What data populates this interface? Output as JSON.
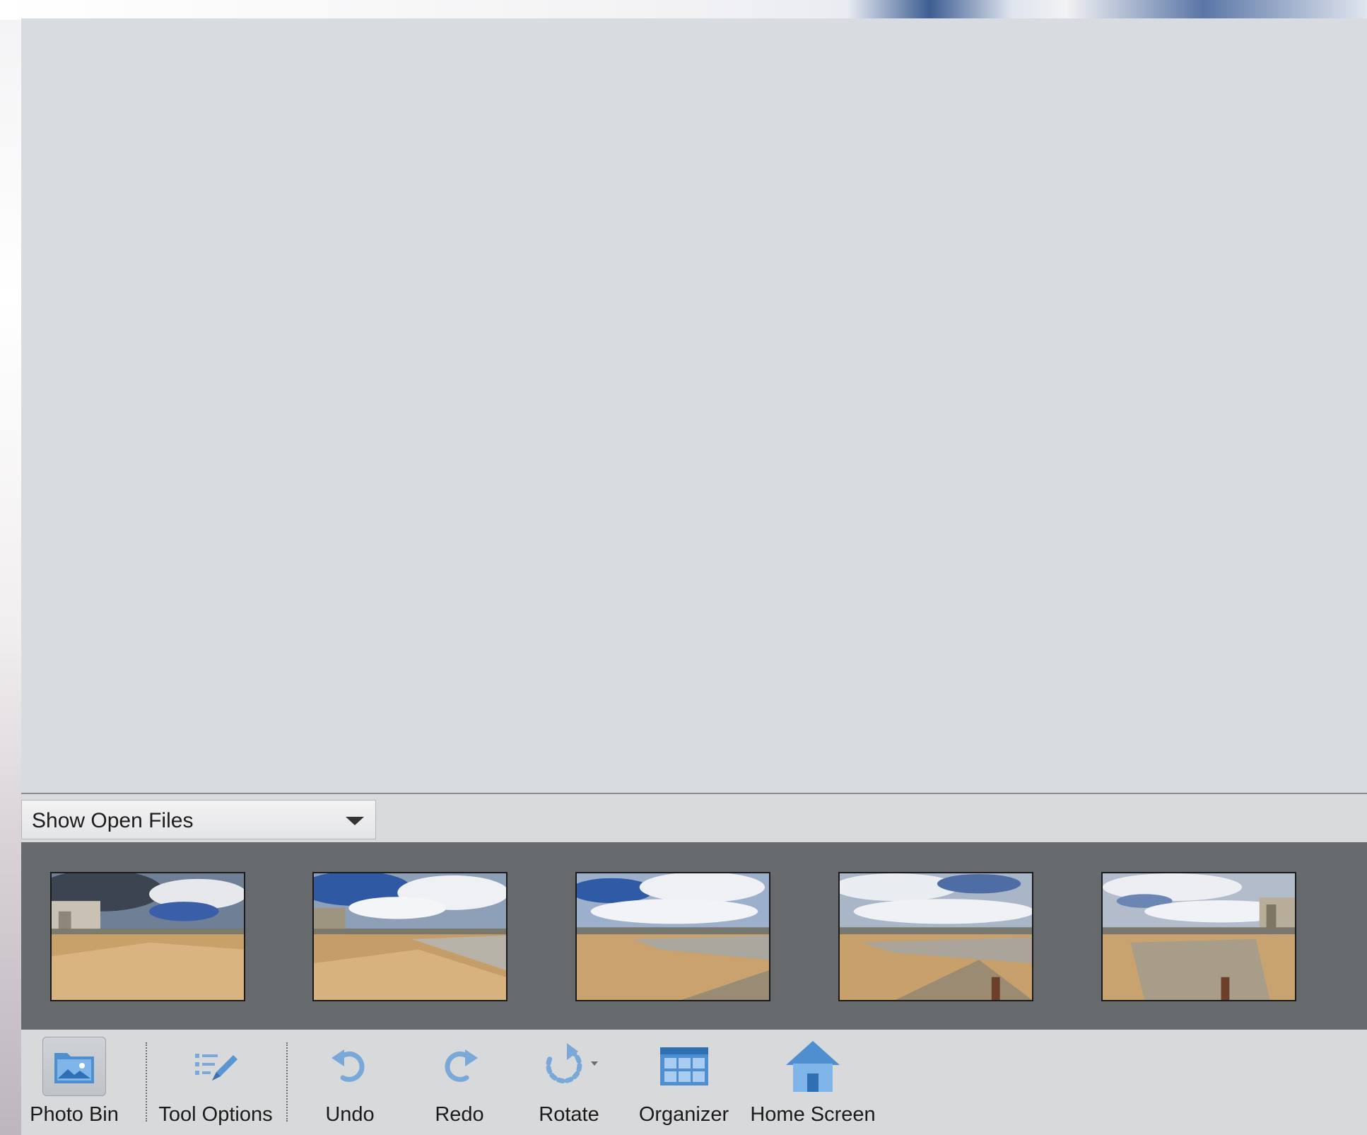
{
  "bin_header": {
    "dropdown": {
      "selected": "Show Open Files"
    }
  },
  "photo_bin": {
    "thumbnails": [
      {
        "name": "thumb-1"
      },
      {
        "name": "thumb-2"
      },
      {
        "name": "thumb-3"
      },
      {
        "name": "thumb-4"
      },
      {
        "name": "thumb-5"
      }
    ]
  },
  "toolbar": {
    "photo_bin": {
      "label": "Photo Bin",
      "icon": "photo-bin-icon",
      "active": true
    },
    "tool_options": {
      "label": "Tool Options",
      "icon": "tool-options-icon"
    },
    "undo": {
      "label": "Undo",
      "icon": "undo-icon"
    },
    "redo": {
      "label": "Redo",
      "icon": "redo-icon"
    },
    "rotate": {
      "label": "Rotate",
      "icon": "rotate-icon"
    },
    "organizer": {
      "label": "Organizer",
      "icon": "organizer-icon"
    },
    "home_screen": {
      "label": "Home Screen",
      "icon": "home-icon"
    }
  },
  "colors": {
    "canvas": "#d8dbdf",
    "bin": "#676a6d",
    "icon_blue": "#5b9bd5"
  }
}
